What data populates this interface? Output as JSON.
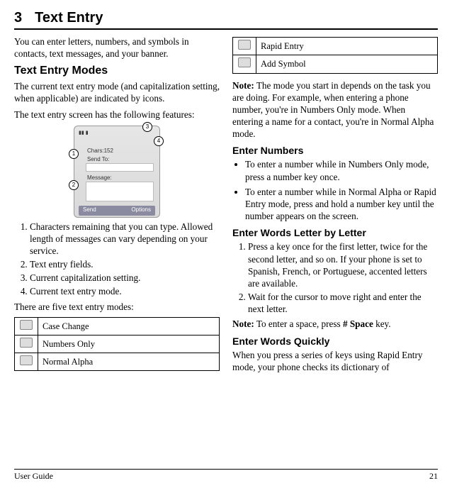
{
  "chapter": {
    "num": "3",
    "title": "Text Entry"
  },
  "left": {
    "intro": "You can enter letters, numbers, and symbols in contacts, text messages, and your banner.",
    "h2": "Text Entry Modes",
    "p1": "The current text entry mode (and capitalization setting, when applicable) are indicated by icons.",
    "p2": "The text entry screen has the following features:",
    "fig": {
      "chars": "Chars:152",
      "sendto": "Send To:",
      "message": "Message:",
      "soft_left": "Send",
      "soft_right": "Options",
      "c1": "1",
      "c2": "2",
      "c3": "3",
      "c4": "4"
    },
    "list": {
      "i1": "Characters remaining that you can type. Allowed length of messages can vary depending on your service.",
      "i2": "Text entry fields.",
      "i3": "Current capitalization setting.",
      "i4": "Current text entry mode."
    },
    "after_list": "There are five text entry modes:",
    "modes": {
      "m1": "Case Change",
      "m2": "Numbers Only",
      "m3": "Normal Alpha"
    }
  },
  "right": {
    "modes": {
      "m4": "Rapid Entry",
      "m5": "Add Symbol"
    },
    "note1_label": "Note:",
    "note1": " The mode you start in depends on the task you are doing. For example, when entering a phone number, you're in Numbers Only mode. When entering a name for a contact, you're in Normal Alpha mode.",
    "h3a": "Enter Numbers",
    "b1": "To enter a number while in Numbers Only mode, press a number key once.",
    "b2": "To enter a number while in Normal Alpha or Rapid Entry mode, press and hold a number key until the number appears on the screen.",
    "h3b": "Enter Words Letter by Letter",
    "n1": "Press a key once for the first letter, twice for the second letter, and so on. If your phone is set to Spanish, French, or Portuguese, accented letters are available.",
    "n2": "Wait for the cursor to move right and enter the next letter.",
    "note2_label": "Note:",
    "note2_a": " To enter a space, press ",
    "note2_key": "# Space",
    "note2_b": " key.",
    "h3c": "Enter Words Quickly",
    "p_last": "When you press a series of keys using Rapid Entry mode, your phone checks its dictionary of"
  },
  "footer": {
    "left": "User Guide",
    "right": "21"
  }
}
